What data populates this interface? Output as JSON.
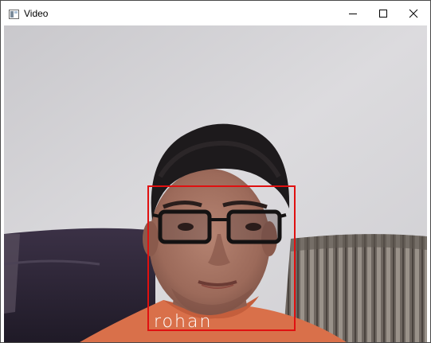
{
  "window": {
    "title": "Video",
    "icon": "opencv-window-icon",
    "controls": {
      "minimize_icon": "minimize-icon",
      "maximize_icon": "maximize-icon",
      "close_icon": "close-icon"
    }
  },
  "video": {
    "detection": {
      "label": "rohan",
      "box_color": "#e01010"
    }
  }
}
